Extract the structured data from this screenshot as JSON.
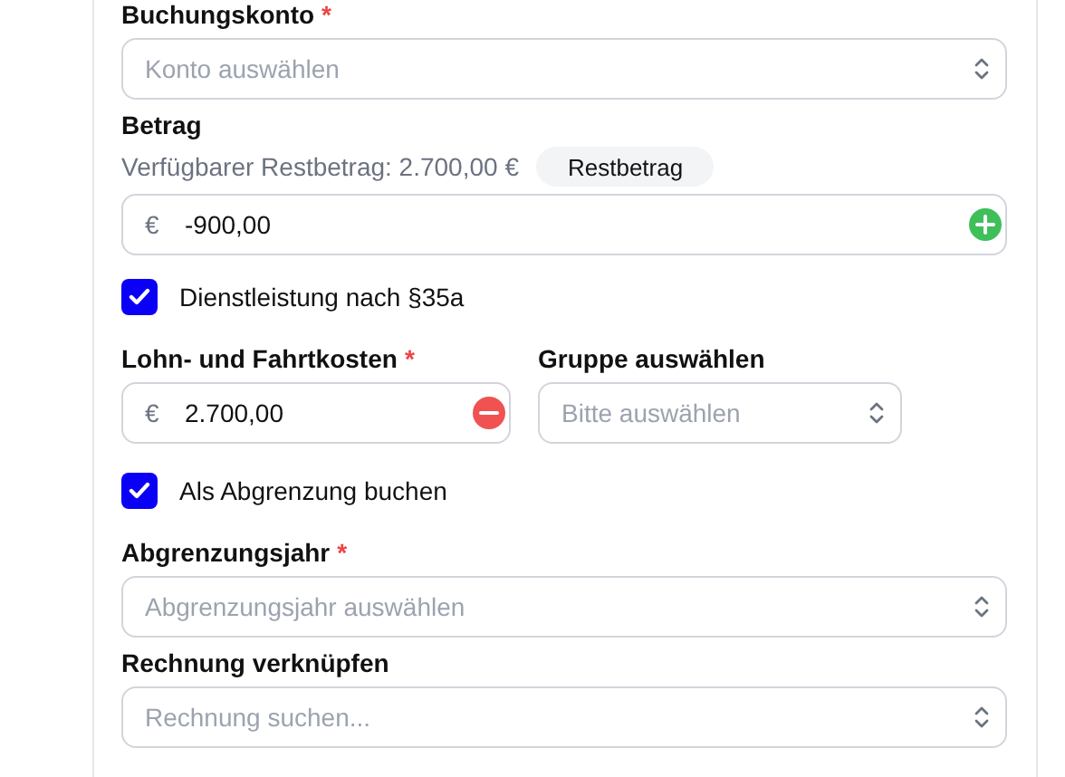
{
  "fields": [
    {
      "kind": "select",
      "label": "Buchungskonto",
      "required_mark": "*",
      "placeholder": "Konto auswählen"
    },
    {
      "kind": "amount",
      "label": "Betrag",
      "hint": "Verfügbarer Restbetrag: 2.700,00 €",
      "hint_button": "Restbetrag",
      "currency": "€",
      "value": "-900,00",
      "action_button": {
        "kind": "add"
      }
    },
    {
      "kind": "checkbox",
      "label": "Dienstleistung nach §35a",
      "checked": true
    },
    {
      "kind": "pair",
      "items": [
        {
          "kind": "amount",
          "label": "Lohn- und Fahrtkosten",
          "required_mark": "*",
          "currency": "€",
          "value": "2.700,00",
          "action_button": {
            "kind": "remove"
          }
        },
        {
          "kind": "select",
          "label": "Gruppe auswählen",
          "placeholder": "Bitte auswählen"
        }
      ]
    },
    {
      "kind": "checkbox",
      "label": "Als Abgrenzung buchen",
      "checked": true
    },
    {
      "kind": "select",
      "label": "Abgrenzungsjahr",
      "required_mark": "*",
      "placeholder": "Abgrenzungsjahr auswählen"
    },
    {
      "kind": "select",
      "label": "Rechnung verknüpfen",
      "placeholder": "Rechnung suchen..."
    }
  ]
}
